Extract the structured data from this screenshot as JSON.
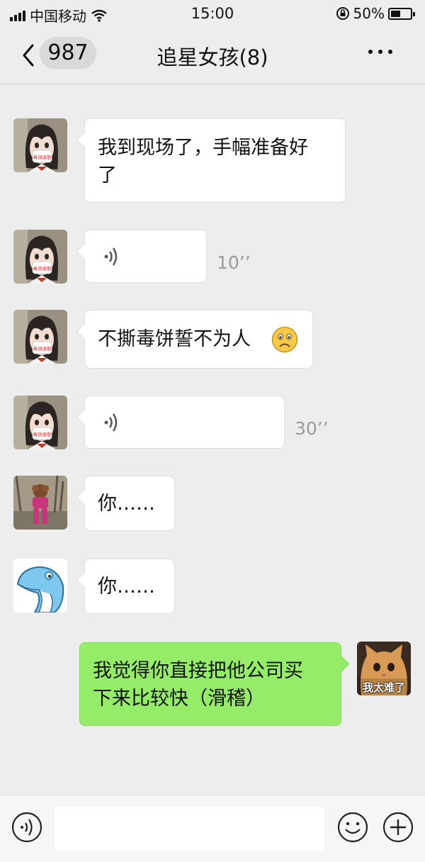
{
  "status_bar": {
    "carrier": "中国移动",
    "time": "15:00",
    "battery": "50%",
    "battery_level": 0.5
  },
  "nav": {
    "unread_count": "987",
    "title": "追星女孩(8)"
  },
  "messages": [
    {
      "side": "left",
      "type": "text",
      "text_line1": "我到现场了，手幅准备好",
      "text_line2": "了"
    },
    {
      "side": "left",
      "type": "voice",
      "duration": "10’’"
    },
    {
      "side": "left",
      "type": "text",
      "text": "不撕毒饼誓不为人",
      "emoji": "frown"
    },
    {
      "side": "left",
      "type": "voice",
      "duration": "30’’"
    },
    {
      "side": "left",
      "type": "text",
      "text": "你……"
    },
    {
      "side": "left",
      "type": "text",
      "text": "你……"
    },
    {
      "side": "right",
      "type": "text",
      "text_line1": "我觉得你直接把他公司买",
      "text_line2": "下来比较快（滑稽）"
    }
  ],
  "self_avatar_caption": "我太难了",
  "mask_text": "毒饼退散",
  "colors": {
    "background": "#ededed",
    "bubble_self": "#95ec69",
    "bubble_other": "#ffffff"
  },
  "icons": [
    "back-chevron-icon",
    "more-dots-icon",
    "voice-wave-icon",
    "voice-toggle-icon",
    "emoji-icon",
    "plus-icon"
  ]
}
